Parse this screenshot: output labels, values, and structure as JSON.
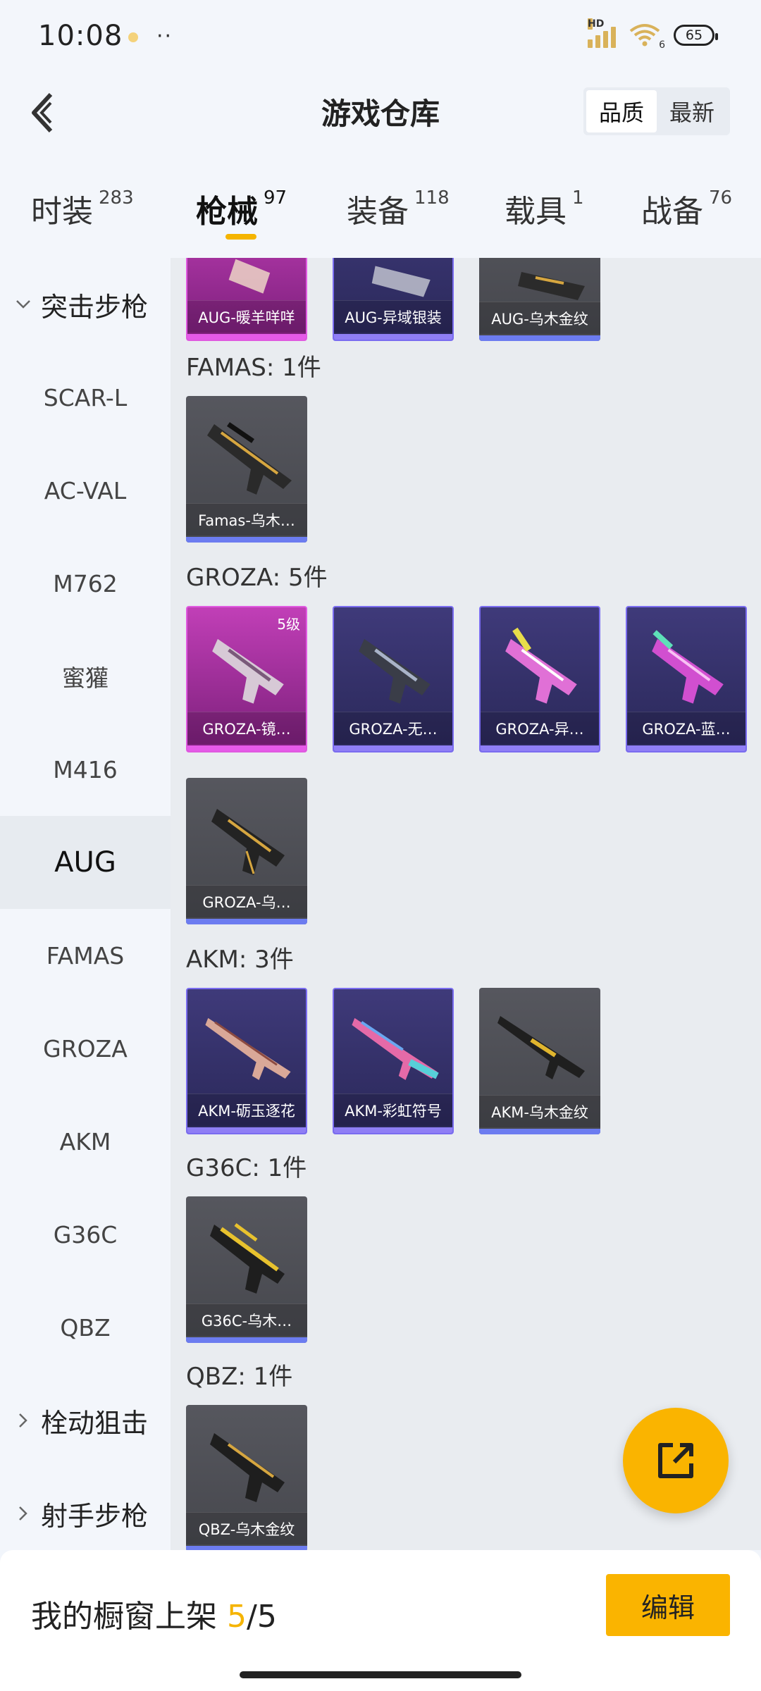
{
  "status_bar": {
    "time": "10:08",
    "dots": "··",
    "signal_label": "HD",
    "wifi_label": "6",
    "battery": "65"
  },
  "header": {
    "title": "游戏仓库",
    "sort_options": [
      "品质",
      "最新"
    ],
    "sort_selected": "品质"
  },
  "tabs": [
    {
      "label": "时装",
      "count": "283"
    },
    {
      "label": "枪械",
      "count": "97"
    },
    {
      "label": "装备",
      "count": "118"
    },
    {
      "label": "载具",
      "count": "1"
    },
    {
      "label": "战备",
      "count": "76"
    }
  ],
  "active_tab": "枪械",
  "sidebar": {
    "category_assault": "突击步枪",
    "items": [
      "SCAR-L",
      "AC-VAL",
      "M762",
      "蜜獾",
      "M416",
      "AUG",
      "FAMAS",
      "GROZA",
      "AKM",
      "G36C",
      "QBZ"
    ],
    "active_item": "AUG",
    "category_bolt": "栓动狙击",
    "category_marksman": "射手步枪"
  },
  "groups": {
    "aug": {
      "cards": [
        {
          "label": "AUG-暖羊咩咩",
          "rarity": "pink"
        },
        {
          "label": "AUG-异域银装",
          "rarity": "purple"
        },
        {
          "label": "AUG-乌木金纹",
          "rarity": "grey"
        }
      ]
    },
    "famas": {
      "title": "FAMAS: 1件",
      "cards": [
        {
          "label": "Famas-乌木…",
          "rarity": "grey"
        }
      ]
    },
    "groza": {
      "title": "GROZA: 5件",
      "cards": [
        {
          "label": "GROZA-镜…",
          "rarity": "pink",
          "badge": "5级"
        },
        {
          "label": "GROZA-无…",
          "rarity": "purple"
        },
        {
          "label": "GROZA-异…",
          "rarity": "purple"
        },
        {
          "label": "GROZA-蓝…",
          "rarity": "purple"
        },
        {
          "label": "GROZA-乌…",
          "rarity": "grey"
        }
      ]
    },
    "akm": {
      "title": "AKM: 3件",
      "cards": [
        {
          "label": "AKM-砺玉逐花",
          "rarity": "purple"
        },
        {
          "label": "AKM-彩虹符号",
          "rarity": "purple"
        },
        {
          "label": "AKM-乌木金纹",
          "rarity": "grey"
        }
      ]
    },
    "g36c": {
      "title": "G36C: 1件",
      "cards": [
        {
          "label": "G36C-乌木…",
          "rarity": "grey"
        }
      ]
    },
    "qbz": {
      "title": "QBZ: 1件",
      "cards": [
        {
          "label": "QBZ-乌木金纹",
          "rarity": "grey"
        }
      ]
    }
  },
  "bottom": {
    "showcase_label": "我的橱窗上架",
    "showcase_current": "5",
    "showcase_sep": "/",
    "showcase_total": "5",
    "edit_label": "编辑"
  },
  "colors": {
    "accent": "#fab400",
    "rarity_pink": "#c13fb7",
    "rarity_purple": "#3f3a7a",
    "rarity_grey": "#56575e"
  },
  "icons": {
    "back": "chevron-left-icon",
    "share": "share-external-icon",
    "expand": "chevron-down-icon",
    "collapse": "chevron-right-icon"
  }
}
